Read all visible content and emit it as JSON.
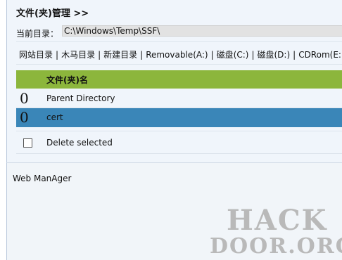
{
  "header": {
    "title": "文件(夹)管理 >>"
  },
  "current_dir": {
    "label": "当前目录：",
    "value": "C:\\Windows\\Temp\\SSF\\"
  },
  "nav": [
    "网站目录",
    "木马目录",
    "新建目录",
    "Removable(A:)",
    "磁盘(C:)",
    "磁盘(D:)",
    "CDRom(E:)"
  ],
  "table": {
    "header": "文件(夹)名",
    "rows": [
      {
        "num": "0",
        "name": "Parent Directory"
      },
      {
        "num": "0",
        "name": "cert"
      }
    ],
    "selected_index": 1
  },
  "delete_label": "Delete selected",
  "footer": "Web ManAger",
  "watermark": {
    "line1": "HACK",
    "line2": "DOOR.ORG"
  },
  "colors": {
    "table_header": "#8cb63c",
    "selected_row": "#3a86b8",
    "panel_bg": "#f0f5fb"
  }
}
